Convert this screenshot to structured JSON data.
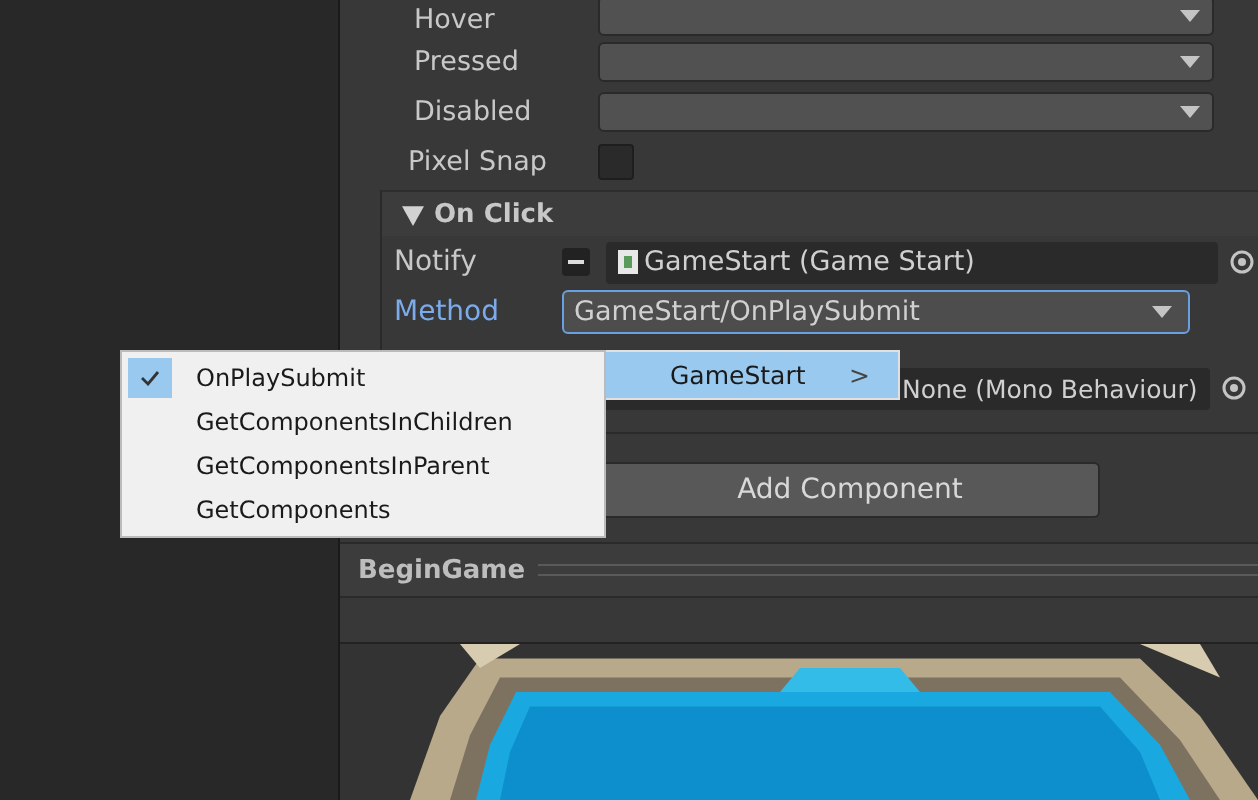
{
  "properties": [
    {
      "label": "Hover",
      "kind": "dropdown"
    },
    {
      "label": "Pressed",
      "kind": "dropdown"
    },
    {
      "label": "Disabled",
      "kind": "dropdown"
    },
    {
      "label": "Pixel Snap",
      "kind": "checkbox",
      "checked": false
    }
  ],
  "on_click": {
    "title": "On Click",
    "expanded": true,
    "notify_label": "Notify",
    "notify_value": "GameStart (Game Start)",
    "method_label": "Method",
    "method_value": "GameStart/OnPlaySubmit",
    "target_value": "None (Mono Behaviour)"
  },
  "add_component": "Add Component",
  "section": "BeginGame",
  "submenu": {
    "label": "GameStart",
    "arrow": ">"
  },
  "menu_items": [
    {
      "label": "OnPlaySubmit",
      "selected": true
    },
    {
      "label": "GetComponentsInChildren",
      "selected": false
    },
    {
      "label": "GetComponentsInParent",
      "selected": false
    },
    {
      "label": "GetComponents",
      "selected": false
    }
  ]
}
